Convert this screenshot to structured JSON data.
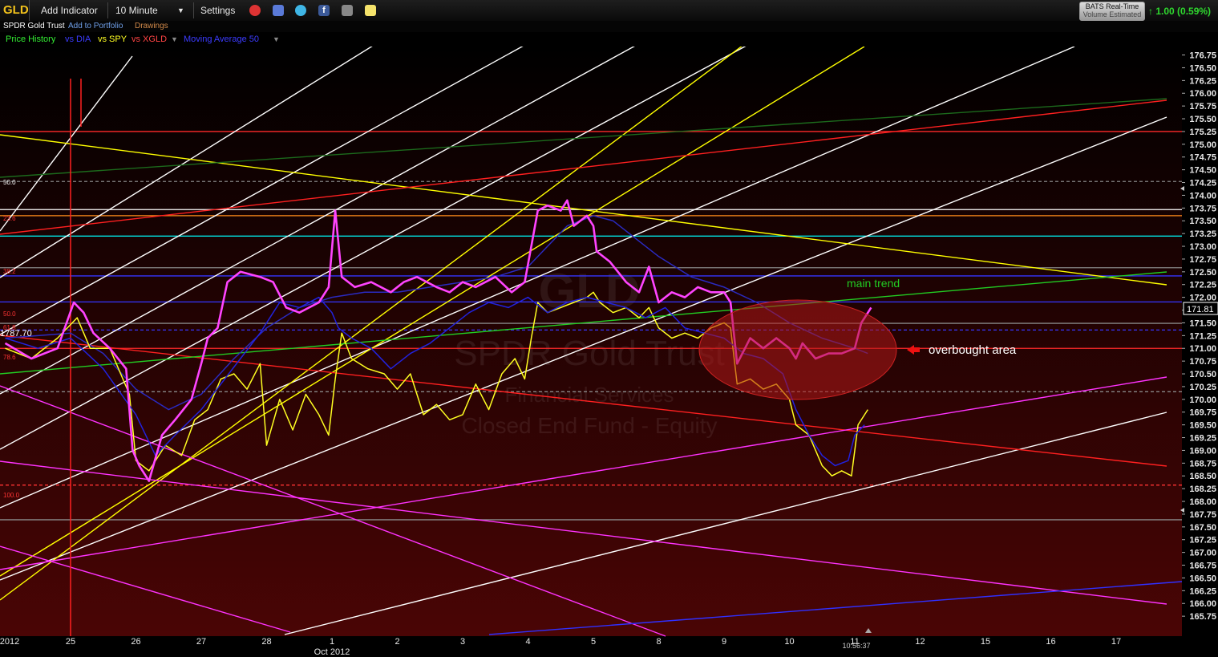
{
  "toolbar": {
    "symbol": "GLD",
    "add_indicator": "Add Indicator",
    "interval": "10 Minute",
    "settings": "Settings",
    "icons": [
      "alarm-clock-icon",
      "notes-icon",
      "twitter-icon",
      "facebook-icon",
      "camera-icon",
      "sticky-note-icon"
    ],
    "bats_line1": "BATS Real-Time",
    "bats_line2": "Volume Estimated",
    "change": "1.00 (0.59%)"
  },
  "header": {
    "title": "SPDR Gold Trust",
    "add_to_portfolio": "Add to Portfolio",
    "drawings": "Drawings"
  },
  "legend": {
    "price_history": "Price History",
    "vs_dia": "vs DIA",
    "vs_spy": "vs SPY",
    "vs_xgld": "vs XGLD",
    "moving_average": "Moving Average 50"
  },
  "watermark": {
    "symbol": "GLD",
    "name": "SPDR Gold Trust",
    "sector": "Financial Services",
    "type": "Closed End Fund - Equity"
  },
  "annotations": {
    "main_trend": "main trend",
    "overbought": "overbought area",
    "fib_labels": [
      "50.0",
      "23.6",
      "38.2",
      "50.0",
      "61.8",
      "78.6",
      "100.0"
    ],
    "price_marker": "171.81",
    "time_marker": "10:56:37",
    "left_value": "1787.70"
  },
  "colors": {
    "price": "#ff44ff",
    "dia": "#2222dd",
    "spy": "#ffff22",
    "ma": "#2a2ac0",
    "main_trend": "#22cc22",
    "overbought": "#b01818"
  },
  "chart_data": {
    "type": "line",
    "title": "",
    "xlabel": "",
    "ylabel": "",
    "ylim": [
      165.6,
      176.9
    ],
    "y_ticks": [
      165.75,
      166.0,
      166.25,
      166.5,
      166.75,
      167.0,
      167.25,
      167.5,
      167.75,
      168.0,
      168.25,
      168.5,
      168.75,
      169.0,
      169.25,
      169.5,
      169.75,
      170.0,
      170.25,
      170.5,
      170.75,
      171.0,
      171.25,
      171.5,
      171.75,
      172.0,
      172.25,
      172.5,
      172.75,
      173.0,
      173.25,
      173.5,
      173.75,
      174.0,
      174.25,
      174.5,
      174.75,
      175.0,
      175.25,
      175.5,
      175.75,
      176.0,
      176.25,
      176.5,
      176.75
    ],
    "x_ticks": [
      {
        "label": "2012",
        "i": -0.9
      },
      {
        "label": "25",
        "i": 0
      },
      {
        "label": "26",
        "i": 1
      },
      {
        "label": "27",
        "i": 2
      },
      {
        "label": "28",
        "i": 3
      },
      {
        "label": "1",
        "i": 4
      },
      {
        "label": "Oct 2012",
        "i": 4
      },
      {
        "label": "2",
        "i": 5
      },
      {
        "label": "3",
        "i": 6
      },
      {
        "label": "4",
        "i": 7
      },
      {
        "label": "5",
        "i": 8
      },
      {
        "label": "8",
        "i": 9
      },
      {
        "label": "9",
        "i": 10
      },
      {
        "label": "10",
        "i": 11
      },
      {
        "label": "11",
        "i": 12
      },
      {
        "label": "12",
        "i": 13
      },
      {
        "label": "15",
        "i": 14
      },
      {
        "label": "16",
        "i": 15
      },
      {
        "label": "17",
        "i": 16
      }
    ],
    "series": [
      {
        "name": "Price History",
        "color": "#ff44ff",
        "points": [
          [
            -1,
            171.1
          ],
          [
            -0.6,
            170.8
          ],
          [
            -0.2,
            171.0
          ],
          [
            0.05,
            171.9
          ],
          [
            0.2,
            171.7
          ],
          [
            0.35,
            171.3
          ],
          [
            0.6,
            171.0
          ],
          [
            0.85,
            170.6
          ],
          [
            0.95,
            169.0
          ],
          [
            1.05,
            168.7
          ],
          [
            1.2,
            168.4
          ],
          [
            1.4,
            169.3
          ],
          [
            1.6,
            169.6
          ],
          [
            1.85,
            170.0
          ],
          [
            2.0,
            170.7
          ],
          [
            2.1,
            171.2
          ],
          [
            2.25,
            171.4
          ],
          [
            2.4,
            172.3
          ],
          [
            2.6,
            172.5
          ],
          [
            2.9,
            172.4
          ],
          [
            3.1,
            172.3
          ],
          [
            3.3,
            171.8
          ],
          [
            3.5,
            171.7
          ],
          [
            3.8,
            171.9
          ],
          [
            3.95,
            172.2
          ],
          [
            4.05,
            173.7
          ],
          [
            4.15,
            172.4
          ],
          [
            4.35,
            172.2
          ],
          [
            4.6,
            172.3
          ],
          [
            4.9,
            172.1
          ],
          [
            5.1,
            172.3
          ],
          [
            5.3,
            172.4
          ],
          [
            5.6,
            172.2
          ],
          [
            5.8,
            172.1
          ],
          [
            6.0,
            172.3
          ],
          [
            6.2,
            172.2
          ],
          [
            6.5,
            172.4
          ],
          [
            6.75,
            172.1
          ],
          [
            6.95,
            172.3
          ],
          [
            7.05,
            173.0
          ],
          [
            7.15,
            173.7
          ],
          [
            7.3,
            173.8
          ],
          [
            7.5,
            173.7
          ],
          [
            7.6,
            173.9
          ],
          [
            7.7,
            173.4
          ],
          [
            7.9,
            173.6
          ],
          [
            8.0,
            173.4
          ],
          [
            8.05,
            172.9
          ],
          [
            8.25,
            172.7
          ],
          [
            8.5,
            172.3
          ],
          [
            8.7,
            172.1
          ],
          [
            8.85,
            172.6
          ],
          [
            9.0,
            171.9
          ],
          [
            9.2,
            172.1
          ],
          [
            9.4,
            172.0
          ],
          [
            9.6,
            172.2
          ],
          [
            9.8,
            172.1
          ],
          [
            10.0,
            172.1
          ],
          [
            10.1,
            171.9
          ],
          [
            10.2,
            170.7
          ],
          [
            10.4,
            171.2
          ],
          [
            10.6,
            171.0
          ],
          [
            10.8,
            171.2
          ],
          [
            11.0,
            171.0
          ],
          [
            11.1,
            170.8
          ],
          [
            11.2,
            171.1
          ],
          [
            11.4,
            170.8
          ],
          [
            11.6,
            170.9
          ],
          [
            11.8,
            170.9
          ],
          [
            12.0,
            171.0
          ],
          [
            12.1,
            171.5
          ],
          [
            12.25,
            171.8
          ]
        ]
      },
      {
        "name": "vs DIA",
        "color": "#2222dd",
        "points": [
          [
            -1,
            171.2
          ],
          [
            -0.5,
            171.0
          ],
          [
            0,
            171.2
          ],
          [
            0.5,
            170.6
          ],
          [
            1,
            169.7
          ],
          [
            1.3,
            168.9
          ],
          [
            1.6,
            169.3
          ],
          [
            2,
            169.8
          ],
          [
            2.3,
            170.3
          ],
          [
            2.6,
            170.8
          ],
          [
            2.9,
            171.3
          ],
          [
            3.2,
            171.9
          ],
          [
            3.5,
            171.8
          ],
          [
            3.8,
            172.0
          ],
          [
            4.0,
            171.7
          ],
          [
            4.1,
            171.4
          ],
          [
            4.3,
            171.2
          ],
          [
            4.6,
            171.0
          ],
          [
            4.9,
            170.6
          ],
          [
            5.2,
            170.9
          ],
          [
            5.5,
            171.1
          ],
          [
            5.8,
            171.4
          ],
          [
            6.1,
            171.7
          ],
          [
            6.4,
            171.9
          ],
          [
            6.7,
            171.8
          ],
          [
            7.0,
            172.0
          ],
          [
            7.3,
            171.7
          ],
          [
            7.6,
            171.9
          ],
          [
            7.9,
            172.0
          ],
          [
            8.2,
            171.9
          ],
          [
            8.5,
            171.8
          ],
          [
            8.8,
            171.6
          ],
          [
            9.1,
            171.8
          ],
          [
            9.4,
            171.4
          ],
          [
            9.7,
            171.3
          ],
          [
            10.0,
            171.2
          ],
          [
            10.3,
            170.9
          ],
          [
            10.6,
            170.8
          ],
          [
            10.9,
            170.5
          ],
          [
            11.1,
            169.8
          ],
          [
            11.3,
            169.3
          ],
          [
            11.5,
            168.9
          ],
          [
            11.7,
            168.7
          ],
          [
            11.9,
            168.8
          ],
          [
            12.0,
            169.3
          ],
          [
            12.15,
            169.5
          ]
        ]
      },
      {
        "name": "vs SPY",
        "color": "#ffff22",
        "points": [
          [
            -1,
            171.0
          ],
          [
            -0.6,
            170.8
          ],
          [
            -0.2,
            171.2
          ],
          [
            0.1,
            171.6
          ],
          [
            0.3,
            171.0
          ],
          [
            0.6,
            171.0
          ],
          [
            0.9,
            170.1
          ],
          [
            1.0,
            168.8
          ],
          [
            1.2,
            168.6
          ],
          [
            1.45,
            169.1
          ],
          [
            1.7,
            168.9
          ],
          [
            1.9,
            169.6
          ],
          [
            2.1,
            169.8
          ],
          [
            2.3,
            170.4
          ],
          [
            2.5,
            170.5
          ],
          [
            2.7,
            170.2
          ],
          [
            2.9,
            170.7
          ],
          [
            3.0,
            169.1
          ],
          [
            3.2,
            170.0
          ],
          [
            3.4,
            169.4
          ],
          [
            3.6,
            170.1
          ],
          [
            3.8,
            169.7
          ],
          [
            3.95,
            169.3
          ],
          [
            4.05,
            170.4
          ],
          [
            4.15,
            171.3
          ],
          [
            4.3,
            170.8
          ],
          [
            4.55,
            170.6
          ],
          [
            4.8,
            170.5
          ],
          [
            5.0,
            170.2
          ],
          [
            5.2,
            170.5
          ],
          [
            5.4,
            169.7
          ],
          [
            5.6,
            169.9
          ],
          [
            5.8,
            169.6
          ],
          [
            6.0,
            169.7
          ],
          [
            6.2,
            170.3
          ],
          [
            6.4,
            169.8
          ],
          [
            6.6,
            170.5
          ],
          [
            6.8,
            170.8
          ],
          [
            6.95,
            170.4
          ],
          [
            7.05,
            171.2
          ],
          [
            7.15,
            171.9
          ],
          [
            7.3,
            171.7
          ],
          [
            7.5,
            171.8
          ],
          [
            7.7,
            171.9
          ],
          [
            7.9,
            172.0
          ],
          [
            8.0,
            172.1
          ],
          [
            8.1,
            171.9
          ],
          [
            8.3,
            171.7
          ],
          [
            8.5,
            171.8
          ],
          [
            8.7,
            171.6
          ],
          [
            8.85,
            171.8
          ],
          [
            9.0,
            171.4
          ],
          [
            9.2,
            171.2
          ],
          [
            9.4,
            171.3
          ],
          [
            9.6,
            171.2
          ],
          [
            9.8,
            171.4
          ],
          [
            10.0,
            171.5
          ],
          [
            10.1,
            171.4
          ],
          [
            10.2,
            170.3
          ],
          [
            10.4,
            170.4
          ],
          [
            10.6,
            170.2
          ],
          [
            10.8,
            170.3
          ],
          [
            11.0,
            170.0
          ],
          [
            11.1,
            169.5
          ],
          [
            11.3,
            169.3
          ],
          [
            11.5,
            168.7
          ],
          [
            11.65,
            168.5
          ],
          [
            11.8,
            168.6
          ],
          [
            11.95,
            168.5
          ],
          [
            12.05,
            169.5
          ],
          [
            12.2,
            169.8
          ]
        ]
      },
      {
        "name": "Moving Average 50",
        "color": "#2a2ac0",
        "points": [
          [
            -1,
            171.2
          ],
          [
            0,
            171.3
          ],
          [
            0.5,
            170.9
          ],
          [
            1,
            170.2
          ],
          [
            1.5,
            169.8
          ],
          [
            2,
            170.1
          ],
          [
            2.5,
            170.8
          ],
          [
            3,
            171.4
          ],
          [
            3.5,
            171.8
          ],
          [
            4,
            172.0
          ],
          [
            4.5,
            172.1
          ],
          [
            5,
            172.1
          ],
          [
            5.5,
            172.2
          ],
          [
            6,
            172.3
          ],
          [
            6.5,
            172.4
          ],
          [
            7,
            172.6
          ],
          [
            7.3,
            173.0
          ],
          [
            7.6,
            173.4
          ],
          [
            8,
            173.6
          ],
          [
            8.3,
            173.5
          ],
          [
            8.6,
            173.2
          ],
          [
            9,
            172.8
          ],
          [
            9.5,
            172.4
          ],
          [
            10,
            172.2
          ],
          [
            10.5,
            171.9
          ],
          [
            11,
            171.5
          ],
          [
            11.5,
            171.2
          ],
          [
            12,
            171.0
          ],
          [
            12.2,
            170.9
          ]
        ]
      }
    ],
    "horizontal_levels": [
      175.25,
      174.27,
      173.72,
      173.6,
      173.2,
      172.58,
      172.42,
      171.91,
      171.49,
      171.36,
      171.0,
      170.15,
      168.32,
      167.64
    ],
    "trendlines_note": "white parallel channel lines, yellow parallel lines, red sloped lines, magenta sloped lines, green main trend line, blue line near bottom"
  }
}
